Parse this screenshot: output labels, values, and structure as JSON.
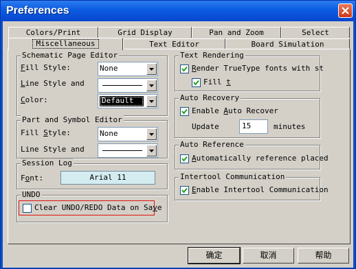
{
  "window": {
    "title": "Preferences"
  },
  "tabs_row1": [
    "Colors/Print",
    "Grid Display",
    "Pan and Zoom",
    "Select"
  ],
  "tabs_row2": [
    "Miscellaneous",
    "Text Editor",
    "Board Simulation"
  ],
  "schematic": {
    "title": "Schematic Page Editor",
    "fill_label": "Fill Style:",
    "fill_value": "None",
    "line_label": "Line Style and",
    "color_label": "Color:",
    "color_value": "Default"
  },
  "part": {
    "title": "Part and Symbol Editor",
    "fill_label": "Fill Style:",
    "fill_value": "None",
    "line_label": "Line Style and"
  },
  "session": {
    "title": "Session Log",
    "font_label": "Font:",
    "font_value": "Arial 11"
  },
  "undo": {
    "title": "UNDO",
    "checkbox_label": "Clear UNDO/REDO Data on Save",
    "checked": false
  },
  "text_rendering": {
    "title": "Text Rendering",
    "truetype_label": "Render TrueType fonts with st",
    "truetype_checked": true,
    "fill_label": "Fill t",
    "fill_checked": true
  },
  "auto_recovery": {
    "title": "Auto Recovery",
    "enable_label": "Enable Auto Recover",
    "enable_checked": true,
    "update_label": "Update",
    "update_value": "15",
    "minutes_label": "minutes"
  },
  "auto_reference": {
    "title": "Auto Reference",
    "label": "Automatically reference placed",
    "checked": true
  },
  "intertool": {
    "title": "Intertool Communication",
    "label": "Enable Intertool Communication",
    "checked": true
  },
  "buttons": {
    "ok": "确定",
    "cancel": "取消",
    "help": "帮助"
  },
  "colors": {
    "titlebar": "#0c5be0",
    "face": "#d4d0c8",
    "highlight_border": "#e01010"
  }
}
